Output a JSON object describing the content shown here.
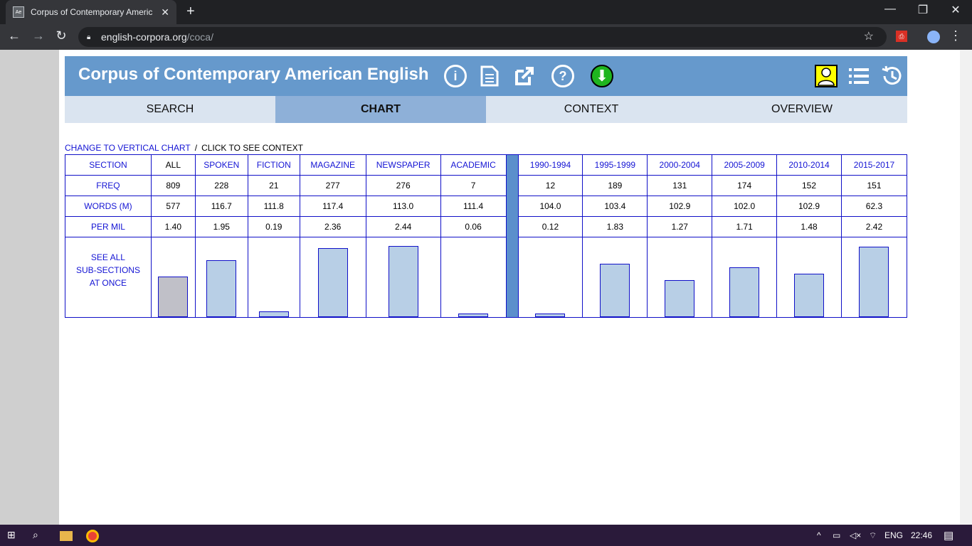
{
  "browser": {
    "tab_title": "Corpus of Contemporary Americ",
    "favicon_text": "Ae",
    "url_host": "english-corpora.org",
    "url_path": "/coca/"
  },
  "site": {
    "title": "Corpus of Contemporary American English",
    "icons": [
      "info-icon",
      "document-icon",
      "external-link-icon",
      "help-icon",
      "download-icon",
      "user-icon",
      "list-icon",
      "history-icon"
    ]
  },
  "nav": {
    "tabs": [
      "SEARCH",
      "CHART",
      "CONTEXT",
      "OVERVIEW"
    ],
    "active": "CHART"
  },
  "chart_links": {
    "vertical": "CHANGE TO VERTICAL CHART",
    "separator": "/",
    "context": "CLICK TO SEE CONTEXT"
  },
  "table": {
    "row_labels": [
      "SECTION",
      "FREQ",
      "WORDS (M)",
      "PER MIL"
    ],
    "see_all_lines": [
      "SEE ALL",
      "SUB-SECTIONS",
      "AT ONCE"
    ],
    "columns": [
      {
        "section": "ALL",
        "freq": "809",
        "words": "577",
        "per_mil": "1.40"
      },
      {
        "section": "SPOKEN",
        "freq": "228",
        "words": "116.7",
        "per_mil": "1.95"
      },
      {
        "section": "FICTION",
        "freq": "21",
        "words": "111.8",
        "per_mil": "0.19"
      },
      {
        "section": "MAGAZINE",
        "freq": "277",
        "words": "117.4",
        "per_mil": "2.36"
      },
      {
        "section": "NEWSPAPER",
        "freq": "276",
        "words": "113.0",
        "per_mil": "2.44"
      },
      {
        "section": "ACADEMIC",
        "freq": "7",
        "words": "111.4",
        "per_mil": "0.06"
      },
      {
        "section": "1990-1994",
        "freq": "12",
        "words": "104.0",
        "per_mil": "0.12"
      },
      {
        "section": "1995-1999",
        "freq": "189",
        "words": "103.4",
        "per_mil": "1.83"
      },
      {
        "section": "2000-2004",
        "freq": "131",
        "words": "102.9",
        "per_mil": "1.27"
      },
      {
        "section": "2005-2009",
        "freq": "174",
        "words": "102.0",
        "per_mil": "1.71"
      },
      {
        "section": "2010-2014",
        "freq": "152",
        "words": "102.9",
        "per_mil": "1.48"
      },
      {
        "section": "2015-2017",
        "freq": "151",
        "words": "62.3",
        "per_mil": "2.42"
      }
    ]
  },
  "chart_data": {
    "type": "bar",
    "categories": [
      "ALL",
      "SPOKEN",
      "FICTION",
      "MAGAZINE",
      "NEWSPAPER",
      "ACADEMIC",
      "1990-1994",
      "1995-1999",
      "2000-2004",
      "2005-2009",
      "2010-2014",
      "2015-2017"
    ],
    "values": [
      1.4,
      1.95,
      0.19,
      2.36,
      2.44,
      0.06,
      0.12,
      1.83,
      1.27,
      1.71,
      1.48,
      2.42
    ],
    "ylabel": "",
    "ylim": [
      0,
      2.44
    ]
  },
  "taskbar": {
    "language": "ENG",
    "time": "22:46"
  }
}
